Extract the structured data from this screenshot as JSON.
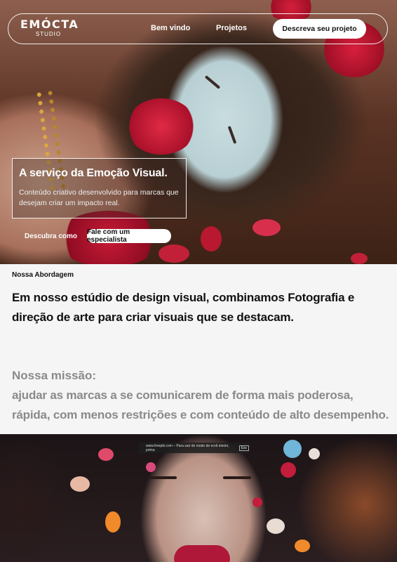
{
  "nav": {
    "logo_main": "EMÓCTA",
    "logo_sub": "STUDIO",
    "links": [
      "Bem vindo",
      "Projetos"
    ],
    "cta_label": "Descreva seu projeto"
  },
  "hero": {
    "title": "A serviço da Emoção Visual.",
    "description": "Conteúdo criativo desenvolvido para marcas que desejam criar um impacto real.",
    "secondary_link": "Descubra como",
    "primary_button": "Fale com um especialista"
  },
  "about": {
    "label": "Nossa Abordagem",
    "text": "Em nosso estúdio de design visual, combinamos Fotografia e direção de arte para criar visuais que se destacam.",
    "mission_title": "Nossa missão:",
    "mission_text": "ajudar as marcas a se comunicarem de forma mais poderosa, rápida, com menos restrições e com conteúdo de alto desempenho."
  },
  "fullscreen_notice": {
    "text": "www.freepik.com – Para sair do modo de ecrã inteiro, prima",
    "key": "Esc"
  },
  "colors": {
    "accent_red": "#c21d3a",
    "muted_text": "#8a8a8a",
    "background": "#f5f5f5"
  }
}
